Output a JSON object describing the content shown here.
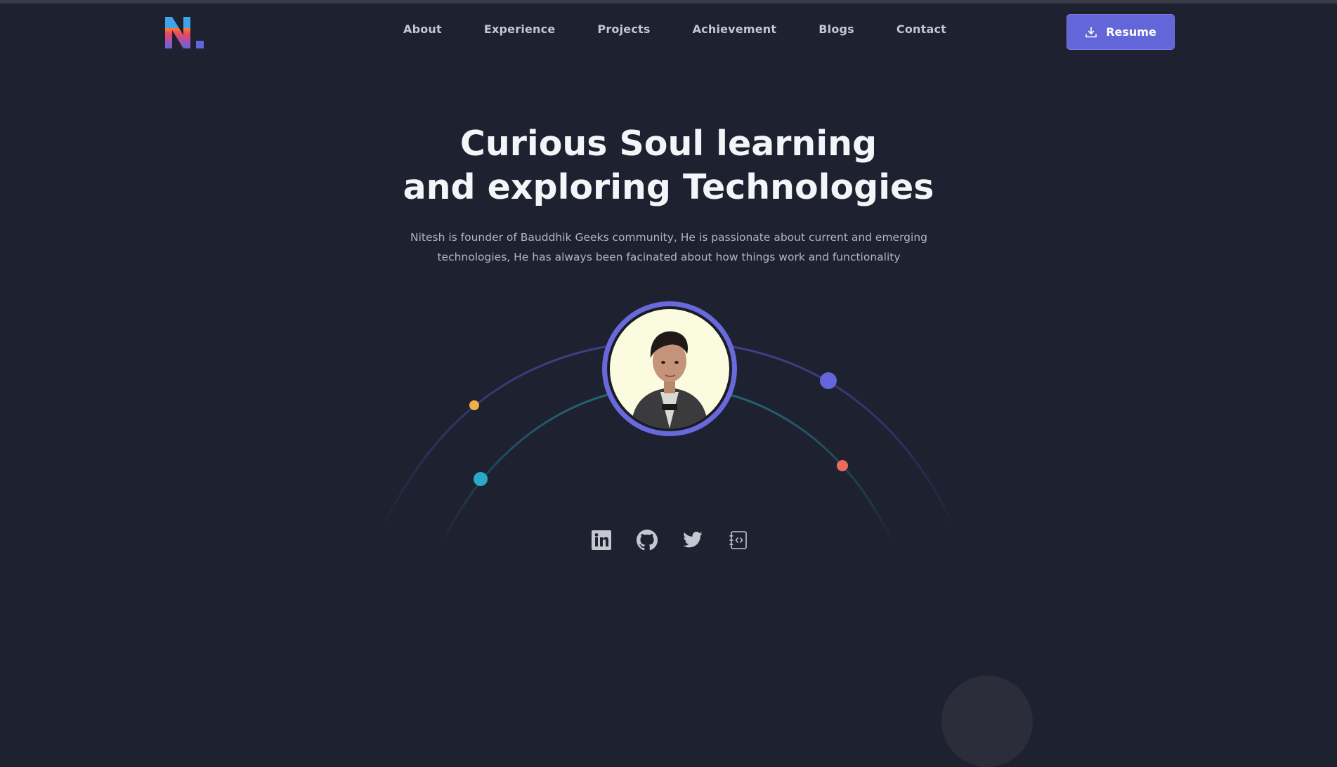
{
  "brand": {
    "logo_text": "N."
  },
  "nav": {
    "items": [
      {
        "label": "About"
      },
      {
        "label": "Experience"
      },
      {
        "label": "Projects"
      },
      {
        "label": "Achievement"
      },
      {
        "label": "Blogs"
      },
      {
        "label": "Contact"
      }
    ],
    "resume_label": "Resume",
    "resume_icon": "download-icon"
  },
  "hero": {
    "title_line1": "Curious Soul learning",
    "title_line2": "and exploring Technologies",
    "description": "Nitesh is founder of Bauddhik Geeks community, He is passionate about current and emerging technologies, He has always been facinated about how things work and functionality",
    "avatar": "profile-photo"
  },
  "socials": [
    {
      "icon": "linkedin-icon"
    },
    {
      "icon": "github-icon"
    },
    {
      "icon": "twitter-icon"
    },
    {
      "icon": "dev-blog-icon"
    }
  ],
  "colors": {
    "background": "#1e2130",
    "accent": "#6366d8",
    "orbit_dot_orange": "#f4ad4b",
    "orbit_dot_cyan": "#2aa9c9",
    "orbit_dot_indigo": "#6366d8",
    "orbit_dot_red": "#ef6a5b"
  }
}
